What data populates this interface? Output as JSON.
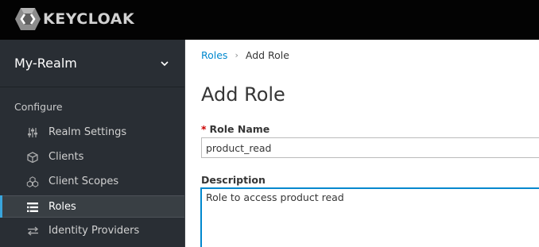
{
  "app": {
    "logo_text": "KEYCLOAK",
    "brand_color": "#0088ce"
  },
  "sidebar": {
    "realm_name": "My-Realm",
    "section_title": "Configure",
    "items": [
      {
        "label": "Realm Settings",
        "icon": "sliders-icon",
        "active": false
      },
      {
        "label": "Clients",
        "icon": "cube-icon",
        "active": false
      },
      {
        "label": "Client Scopes",
        "icon": "cubes-icon",
        "active": false
      },
      {
        "label": "Roles",
        "icon": "list-icon",
        "active": true
      },
      {
        "label": "Identity Providers",
        "icon": "exchange-icon",
        "active": false
      }
    ]
  },
  "breadcrumb": {
    "parent": "Roles",
    "separator": "›",
    "current": "Add Role"
  },
  "page": {
    "title": "Add Role"
  },
  "form": {
    "role_name": {
      "required_marker": "*",
      "label": "Role Name",
      "value": "product_read"
    },
    "description": {
      "label": "Description",
      "value": "Role to access product read"
    }
  }
}
